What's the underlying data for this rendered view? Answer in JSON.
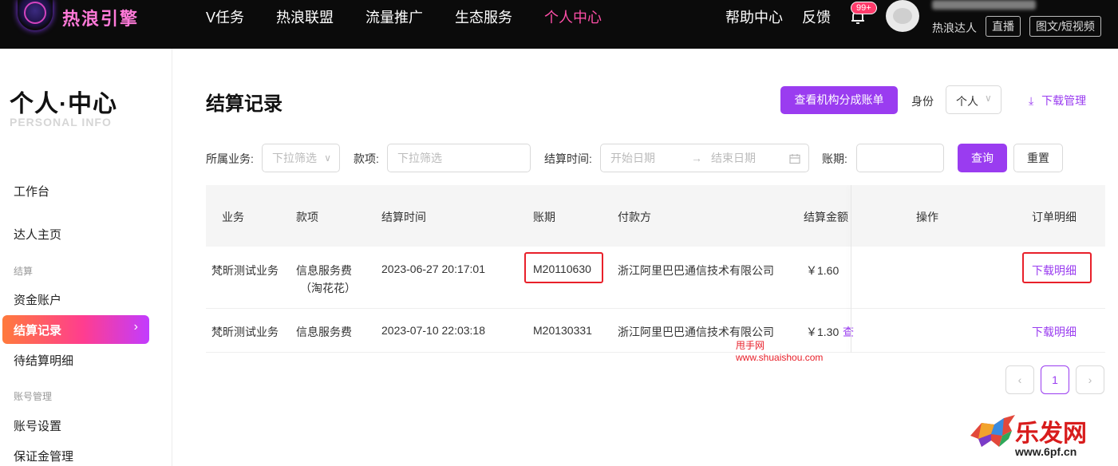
{
  "brand": {
    "logo_text": "热浪引擎"
  },
  "nav": {
    "items": [
      "V任务",
      "热浪联盟",
      "流量推广",
      "生态服务",
      "个人中心"
    ],
    "active_index": 4,
    "help": "帮助中心",
    "feedback": "反馈",
    "badge": "99+"
  },
  "user": {
    "role": "热浪达人",
    "tag_live": "直播",
    "tag_video": "图文/短视频"
  },
  "sidebar": {
    "title": "个人·中心",
    "subtitle": "PERSONAL INFO",
    "items": {
      "workbench": "工作台",
      "homepage": "达人主页",
      "group_settle": "结算",
      "fund_account": "资金账户",
      "settle_record": "结算记录",
      "pending": "待结算明细",
      "group_account": "账号管理",
      "account_settings": "账号设置",
      "deposit": "保证金管理"
    }
  },
  "page": {
    "title": "结算记录",
    "view_bill_btn": "查看机构分成账单",
    "identity_label": "身份",
    "identity_value": "个人",
    "download_mgmt": "下载管理"
  },
  "filters": {
    "business_label": "所属业务:",
    "business_placeholder": "下拉筛选",
    "item_label": "款项:",
    "item_placeholder": "下拉筛选",
    "time_label": "结算时间:",
    "start_placeholder": "开始日期",
    "end_placeholder": "结束日期",
    "period_label": "账期:",
    "query_btn": "查询",
    "reset_btn": "重置"
  },
  "table": {
    "headers": [
      "业务",
      "款项",
      "结算时间",
      "账期",
      "付款方",
      "结算金额",
      "操作",
      "订单明细"
    ],
    "rows": [
      {
        "business": "梵昕测试业务",
        "item": "信息服务费",
        "item_sub": "（淘花花）",
        "time": "2023-06-27 20:17:01",
        "period": "M20110630",
        "payer": "浙江阿里巴巴通信技术有限公司",
        "amount": "￥1.60",
        "op": "",
        "detail": "下载明细"
      },
      {
        "business": "梵昕测试业务",
        "item": "信息服务费",
        "item_sub": "",
        "time": "2023-07-10 22:03:18",
        "period": "M20130331",
        "payer": "浙江阿里巴巴通信技术有限公司",
        "amount": "￥1.30",
        "op": "查",
        "detail": "下载明细"
      }
    ]
  },
  "pagination": {
    "current": "1",
    "prev": "‹",
    "next": "›"
  },
  "watermarks": {
    "site_cn": "甩手网",
    "site_url": "www.shuaishou.com",
    "logo2": "乐发网",
    "logo2_url": "www.6pf.cn"
  },
  "colors": {
    "accent": "#9a3cf0",
    "active_nav": "#ff4fa8",
    "highlight_box": "#e8202a"
  }
}
